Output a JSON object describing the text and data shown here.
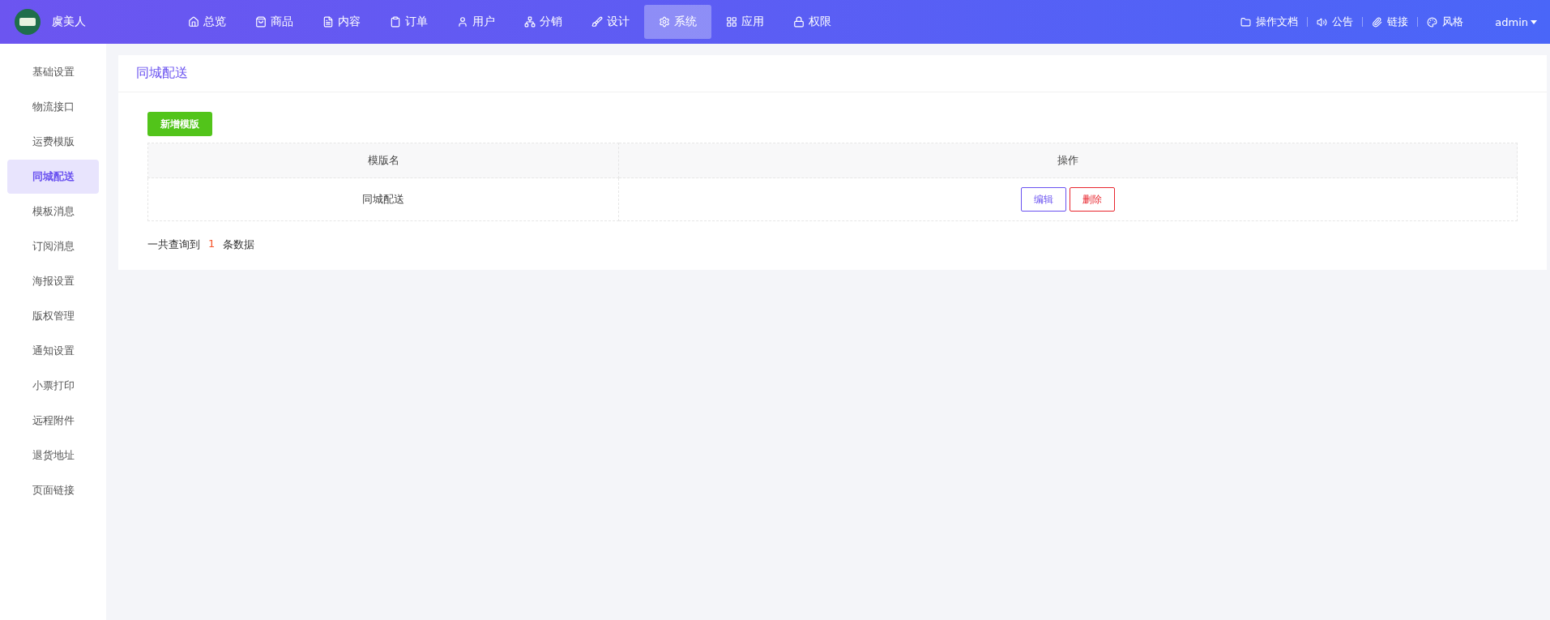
{
  "brand": {
    "name": "虞美人"
  },
  "nav": [
    {
      "label": "总览",
      "selected": false
    },
    {
      "label": "商品",
      "selected": false
    },
    {
      "label": "内容",
      "selected": false
    },
    {
      "label": "订单",
      "selected": false
    },
    {
      "label": "用户",
      "selected": false
    },
    {
      "label": "分销",
      "selected": false
    },
    {
      "label": "设计",
      "selected": false
    },
    {
      "label": "系统",
      "selected": true
    },
    {
      "label": "应用",
      "selected": false
    },
    {
      "label": "权限",
      "selected": false
    }
  ],
  "top_links": [
    {
      "label": "操作文档"
    },
    {
      "label": "公告"
    },
    {
      "label": "链接"
    },
    {
      "label": "风格"
    }
  ],
  "user_menu": "admin",
  "sidebar": {
    "items": [
      {
        "label": "基础设置",
        "selected": false
      },
      {
        "label": "物流接口",
        "selected": false
      },
      {
        "label": "运费模版",
        "selected": false
      },
      {
        "label": "同城配送",
        "selected": true
      },
      {
        "label": "模板消息",
        "selected": false
      },
      {
        "label": "订阅消息",
        "selected": false
      },
      {
        "label": "海报设置",
        "selected": false
      },
      {
        "label": "版权管理",
        "selected": false
      },
      {
        "label": "通知设置",
        "selected": false
      },
      {
        "label": "小票打印",
        "selected": false
      },
      {
        "label": "远程附件",
        "selected": false
      },
      {
        "label": "退货地址",
        "selected": false
      },
      {
        "label": "页面链接",
        "selected": false
      }
    ]
  },
  "panel": {
    "title": "同城配送",
    "add_button": "新增模版",
    "table": {
      "columns": [
        "模版名",
        "操作"
      ],
      "rows": [
        {
          "name": "同城配送",
          "actions": [
            {
              "kind": "edit",
              "label": "编辑"
            },
            {
              "kind": "delete",
              "label": "删除"
            }
          ]
        }
      ]
    },
    "summary": {
      "prefix": "一共查询到",
      "count": "1",
      "suffix": "条数据"
    }
  }
}
